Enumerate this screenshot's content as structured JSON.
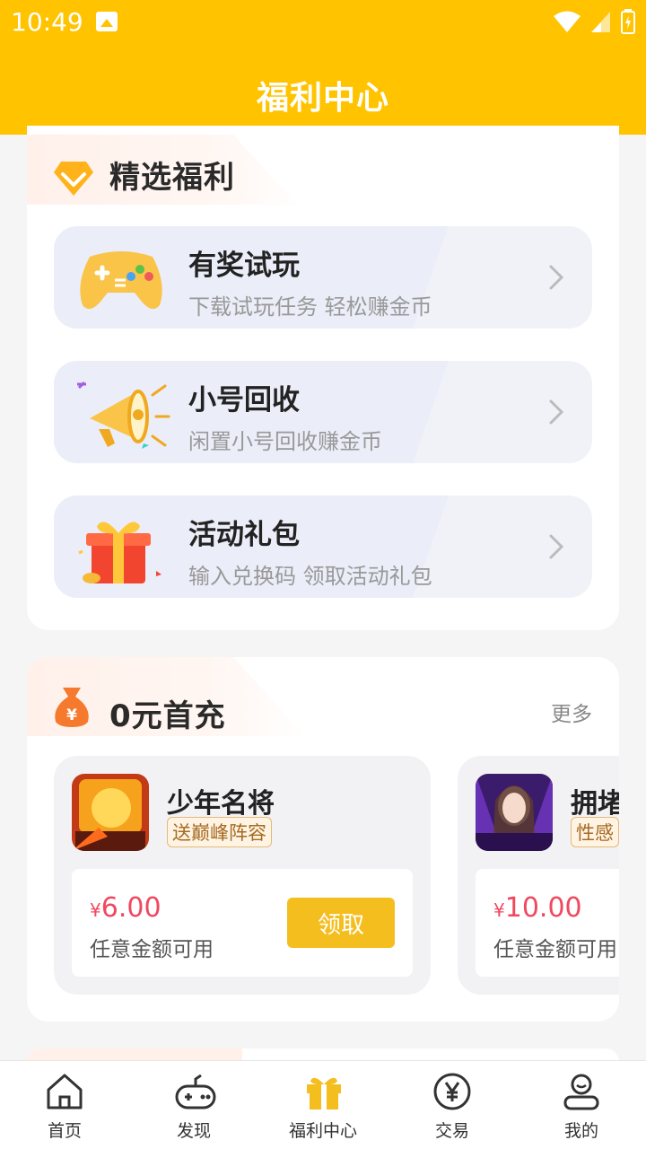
{
  "status_bar": {
    "time": "10:49"
  },
  "header": {
    "title": "福利中心"
  },
  "featured": {
    "title": "精选福利",
    "items": [
      {
        "title": "有奖试玩",
        "subtitle": "下载试玩任务 轻松赚金币",
        "icon": "gamepad-icon"
      },
      {
        "title": "小号回收",
        "subtitle": "闲置小号回收赚金币",
        "icon": "megaphone-icon"
      },
      {
        "title": "活动礼包",
        "subtitle": "输入兑换码 领取活动礼包",
        "icon": "gift-box-icon"
      }
    ]
  },
  "zero_recharge": {
    "title": "0元首充",
    "more_label": "更多",
    "games": [
      {
        "name": "少年名将",
        "tag": "送巅峰阵容",
        "currency": "¥",
        "amount": "6.00",
        "note": "任意金额可用",
        "button": "领取"
      },
      {
        "name": "拥堵",
        "tag": "性感",
        "currency": "¥",
        "amount": "10.00",
        "note": "任意金额可用"
      }
    ]
  },
  "tabs": [
    {
      "label": "首页",
      "icon": "home-icon"
    },
    {
      "label": "发现",
      "icon": "controller-icon"
    },
    {
      "label": "福利中心",
      "icon": "gift-icon",
      "active": true
    },
    {
      "label": "交易",
      "icon": "yen-icon"
    },
    {
      "label": "我的",
      "icon": "user-icon"
    }
  ],
  "colors": {
    "brand": "#ffc300",
    "accent_price": "#f0485f",
    "button": "#f5be1f"
  }
}
